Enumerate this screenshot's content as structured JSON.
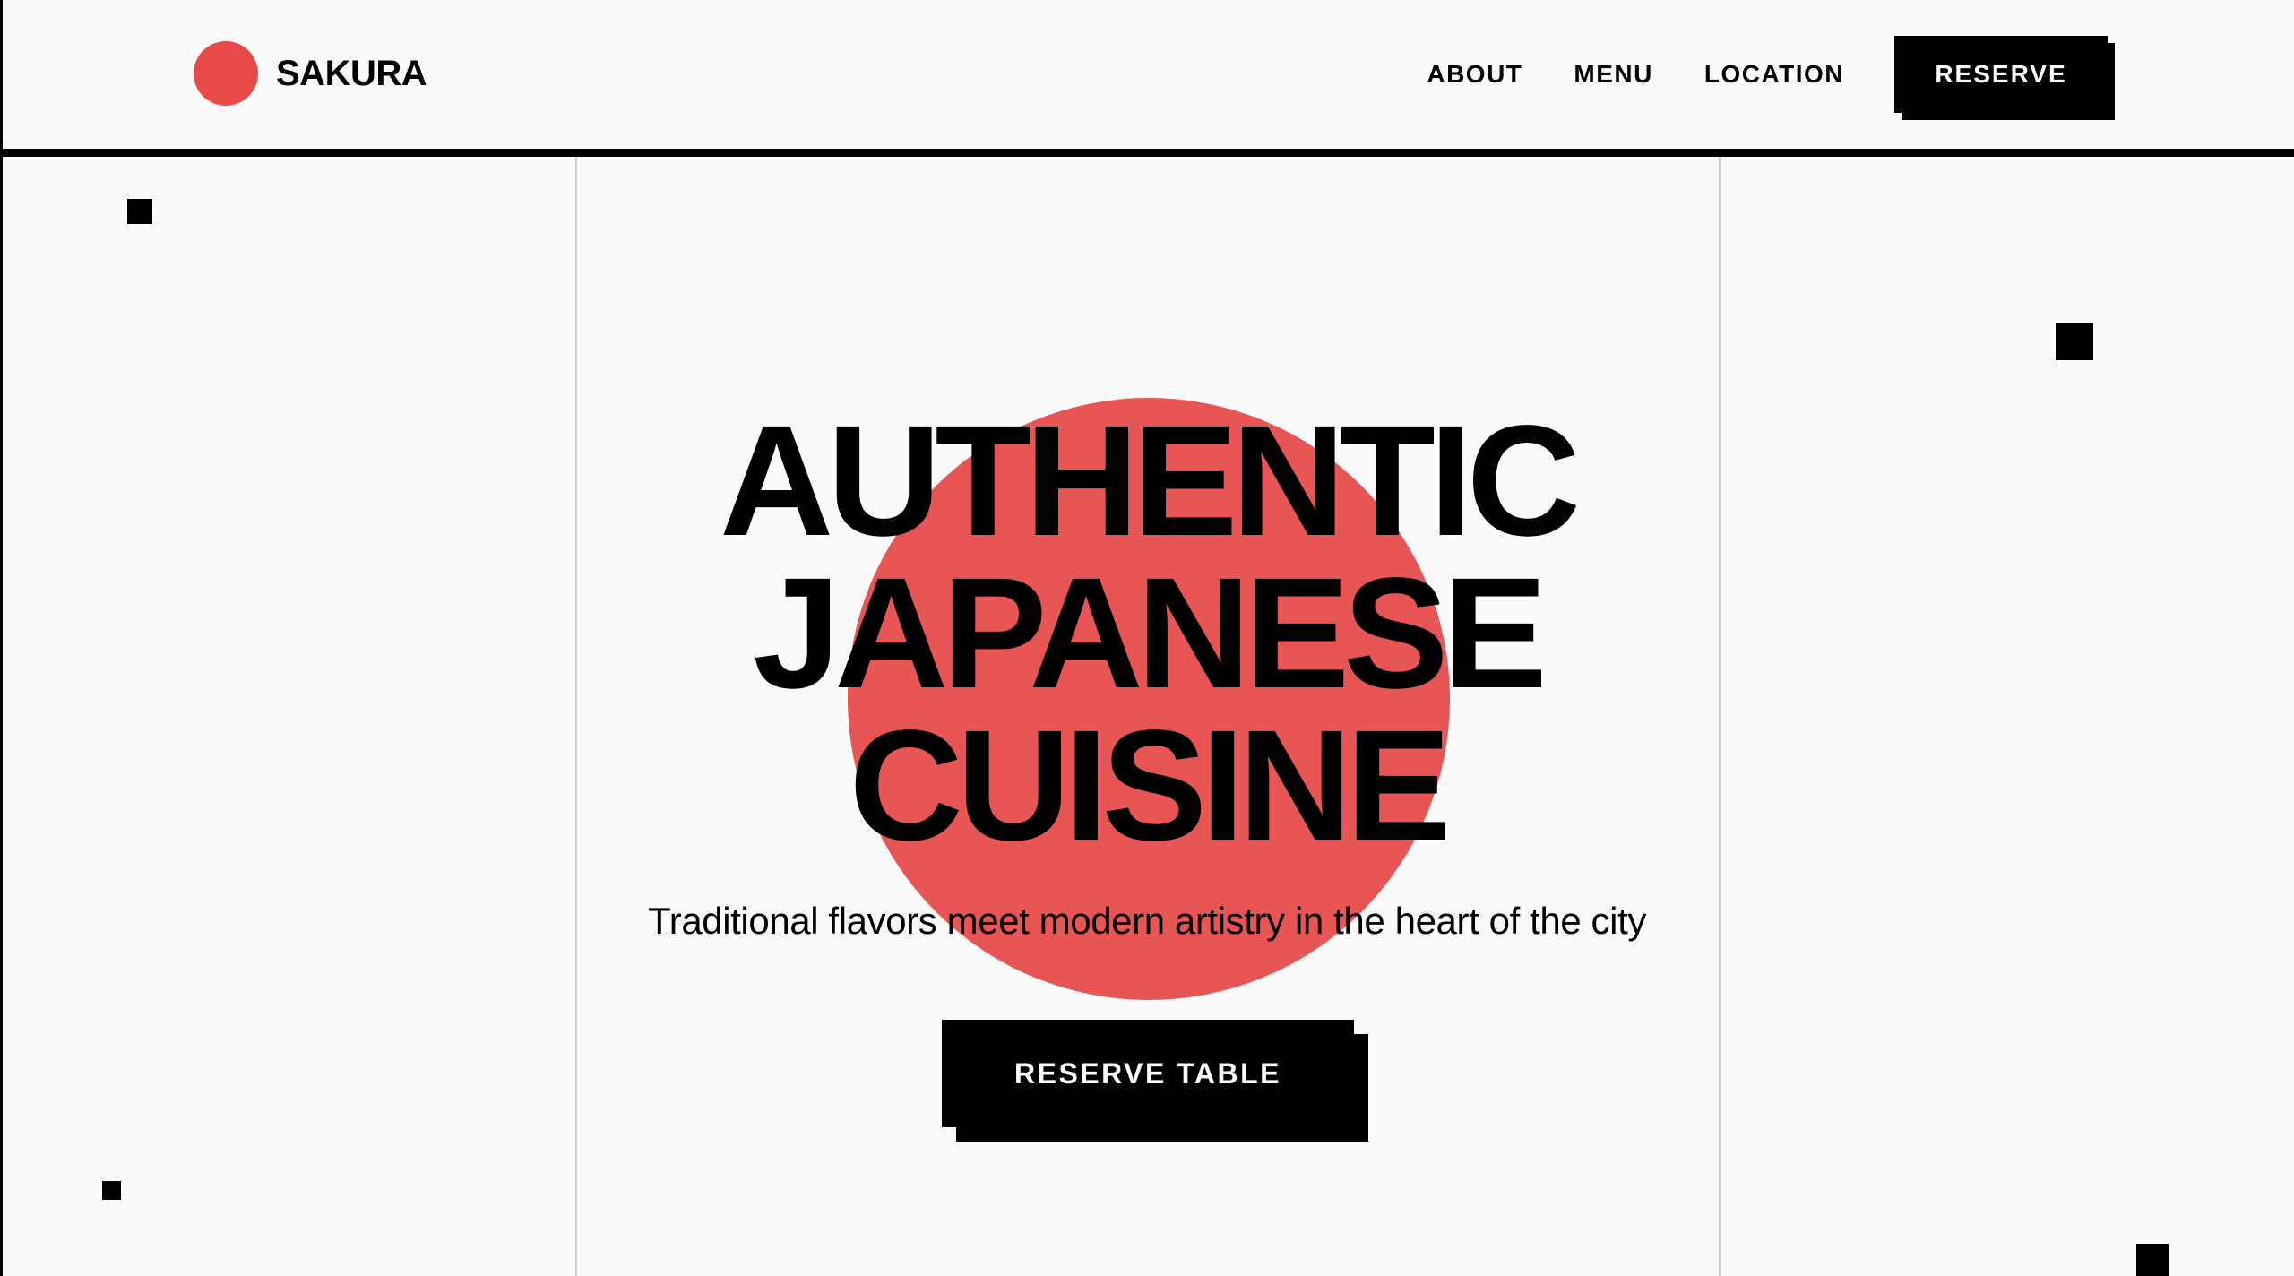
{
  "brand": {
    "name": "SAKURA",
    "accent_color": "#e84a4a"
  },
  "nav": {
    "items": [
      {
        "label": "ABOUT"
      },
      {
        "label": "MENU"
      },
      {
        "label": "LOCATION"
      }
    ],
    "reserve_label": "RESERVE"
  },
  "hero": {
    "title_lines": [
      "AUTHENTIC",
      "JAPANESE",
      "CUISINE"
    ],
    "subtitle": "Traditional flavors meet modern artistry in the heart of the city",
    "cta_label": "RESERVE TABLE",
    "circle_color": "#e85555"
  }
}
